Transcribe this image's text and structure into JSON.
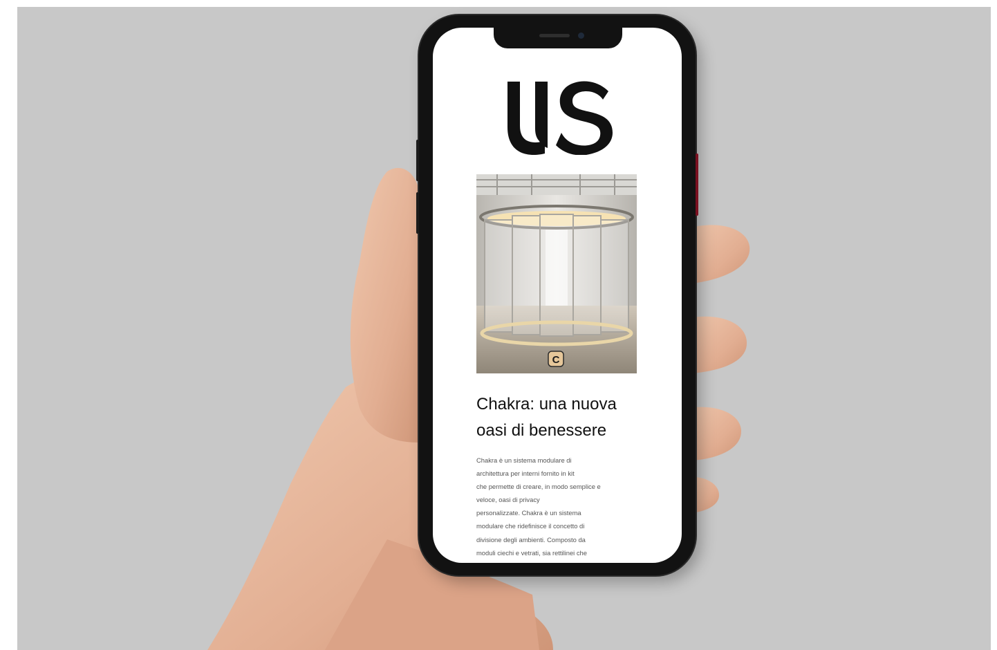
{
  "article": {
    "logo_text": "US",
    "image_badge_letter": "C",
    "headline": "Chakra: una nuova oasi di benessere",
    "body": "Chakra è un sistema modulare di\narchitettura per interni fornito in kit\nche permette di creare, in modo semplice e\nveloce, oasi di privacy\npersonalizzate. Chakra è un sistema\nmodulare che ridefinisce il concetto di\ndivisione degli ambienti. Composto da\nmoduli ciechi e vetrati, sia rettilinei che"
  },
  "colors": {
    "backdrop": "#c8c8c8",
    "skin": "#e6b79c",
    "phone_frame": "#121212",
    "text": "#111111"
  }
}
